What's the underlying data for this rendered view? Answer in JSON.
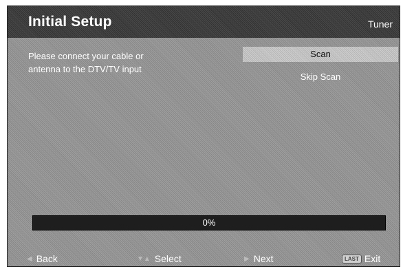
{
  "header": {
    "title": "Initial Setup",
    "context": "Tuner"
  },
  "message": {
    "line1": "Please connect your cable or",
    "line2": "antenna to the DTV/TV input"
  },
  "options": [
    {
      "label": "Scan",
      "selected": true
    },
    {
      "label": "Skip Scan",
      "selected": false
    }
  ],
  "progress": {
    "value": 0,
    "label": "0%"
  },
  "footer": {
    "back": {
      "icon": "left-arrow-icon",
      "label": "Back"
    },
    "select": {
      "icon": "up-down-arrows-icon",
      "label": "Select"
    },
    "next": {
      "icon": "right-arrow-icon",
      "label": "Next"
    },
    "exit": {
      "key": "LAST",
      "label": "Exit"
    }
  },
  "colors": {
    "highlight": "#c8c8c8",
    "header": "#3c3c3c",
    "progress_track": "#1e1e1e"
  }
}
